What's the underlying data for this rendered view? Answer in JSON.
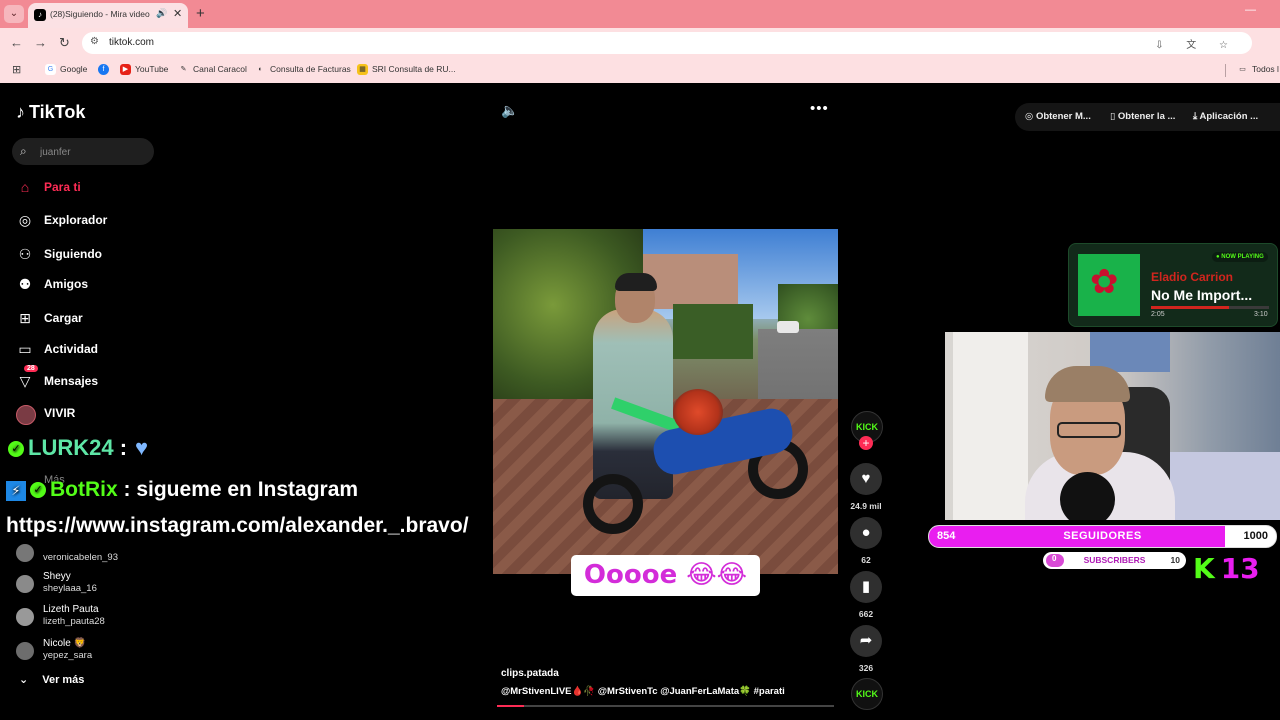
{
  "browser": {
    "tab_title": "(28)Siguiendo - Mira videos",
    "url": "tiktok.com",
    "bookmarks": [
      "Google",
      "YouTube",
      "Canal Caracol",
      "Consulta de Facturas",
      "SRI Consulta de RU..."
    ],
    "all_bookmarks": "Todos l"
  },
  "sidebar": {
    "logo": "TikTok",
    "search_placeholder": "juanfer",
    "nav": [
      {
        "label": "Para ti",
        "icon": "home-icon",
        "active": true
      },
      {
        "label": "Explorador",
        "icon": "compass-icon"
      },
      {
        "label": "Siguiendo",
        "icon": "following-icon"
      },
      {
        "label": "Amigos",
        "icon": "friends-icon"
      },
      {
        "label": "Cargar",
        "icon": "upload-icon"
      },
      {
        "label": "Actividad",
        "icon": "activity-icon"
      },
      {
        "label": "Mensajes",
        "icon": "messages-icon",
        "badge": "28"
      },
      {
        "label": "VIVIR",
        "icon": "live-icon"
      }
    ],
    "more_label": "Más",
    "following_accounts": [
      {
        "name": "",
        "handle": "veronicabelen_93"
      },
      {
        "name": "Sheyy",
        "handle": "sheylaaa_16"
      },
      {
        "name": "Lizeth Pauta",
        "handle": "lizeth_pauta28"
      },
      {
        "name": "Nicole 🦁",
        "handle": "yepez_sara"
      }
    ],
    "see_more": "Ver más"
  },
  "chat": {
    "line1_name": "LURK24",
    "line1_sep": ":",
    "line2_name": "BotRix",
    "line2_text": ": sigueme en Instagram",
    "line3_text": "https://www.instagram.com/alexander._.bravo/"
  },
  "video": {
    "caption": "Ooooe 😂😂",
    "author": "clips.patada",
    "description": "@MrStivenLIVE🩸🥀 @MrStivenTc @JuanFerLaMata🍀 #parati",
    "progress": 0.08
  },
  "actions": {
    "likes": "24.9 mil",
    "comments": "62",
    "saves": "662",
    "shares": "326",
    "kick_label": "KICK"
  },
  "top_actions": [
    "Obtener M...",
    "Obtener la ...",
    "Aplicación ..."
  ],
  "now_playing": {
    "label": "● NOW PLAYING",
    "artist": "Eladio Carrion",
    "title": "No Me Import...",
    "elapsed": "2:05",
    "duration": "3:10",
    "progress": 0.66
  },
  "goals": {
    "followers_current": "854",
    "followers_label": "SEGUIDORES",
    "followers_max": "1000",
    "followers_progress": 0.854,
    "subs_current": "0",
    "subs_label": "SUBSCRIBERS",
    "subs_max": "10",
    "k_label": "K",
    "k_count": "13"
  }
}
